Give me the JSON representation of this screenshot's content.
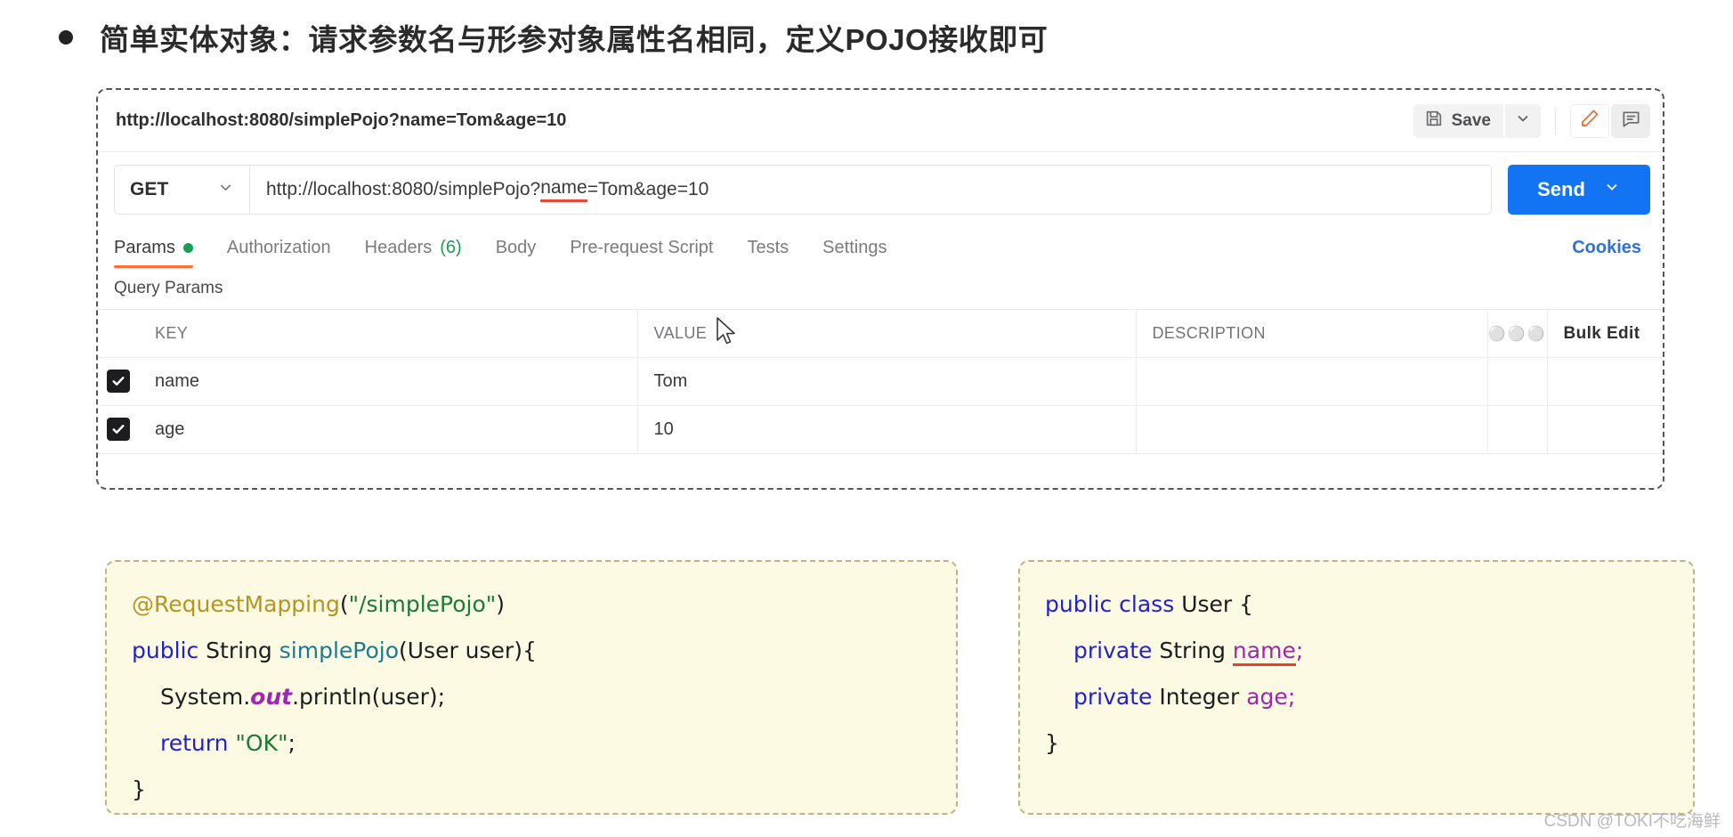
{
  "heading": {
    "bullet": "bullet-dot",
    "text": "简单实体对象：请求参数名与形参对象属性名相同，定义POJO接收即可"
  },
  "postman": {
    "request_name": "http://localhost:8080/simplePojo?name=Tom&age=10",
    "save_label": "Save",
    "save_caret_icon": "chevron-down-icon",
    "save_icon": "floppy-disk-icon",
    "edit_icon": "pencil-icon",
    "comment_icon": "comment-icon",
    "method": "GET",
    "method_caret_icon": "chevron-down-icon",
    "url_prefix": "http://localhost:8080/simplePojo?",
    "url_mark": "name",
    "url_suffix": "=Tom&age=10",
    "send_label": "Send",
    "send_caret_icon": "chevron-down-icon",
    "cookies_label": "Cookies",
    "tabs": [
      {
        "label": "Params",
        "badge": "green-dot",
        "active": true
      },
      {
        "label": "Authorization",
        "active": false
      },
      {
        "label": "Headers",
        "count": "(6)",
        "active": false
      },
      {
        "label": "Body",
        "active": false
      },
      {
        "label": "Pre-request Script",
        "active": false
      },
      {
        "label": "Tests",
        "active": false
      },
      {
        "label": "Settings",
        "active": false
      }
    ],
    "query_params_label": "Query Params",
    "table": {
      "headers": {
        "key": "KEY",
        "value": "VALUE",
        "description": "DESCRIPTION",
        "more_icon": "ellipsis-icon",
        "bulk_edit": "Bulk Edit"
      },
      "rows": [
        {
          "checked": true,
          "key": "name",
          "value": "Tom",
          "description": ""
        },
        {
          "checked": true,
          "key": "age",
          "value": "10",
          "description": ""
        }
      ]
    }
  },
  "code_left": {
    "line1": {
      "annotation": "@RequestMapping",
      "open": "(",
      "string": "\"/simplePojo\"",
      "close": ")"
    },
    "line2": {
      "kw": "public",
      "type": " String ",
      "method": "simplePojo",
      "rest": "(User user){"
    },
    "line3": {
      "a": "System.",
      "b": "out",
      "c": ".println(user);"
    },
    "line4": {
      "kw": "return ",
      "string": "\"OK\"",
      "semi": ";"
    },
    "line5": "}"
  },
  "code_right": {
    "line1": {
      "kw": "public class ",
      "name": "User {"
    },
    "line2": {
      "kw": "private",
      "type": " String ",
      "field": "name",
      "semi": ";"
    },
    "line3": {
      "kw": "private",
      "type": " Integer ",
      "field": "age",
      "semi": ";"
    },
    "line4": "}"
  },
  "watermark": "CSDN @TOKI不吃海鲜",
  "colors": {
    "accent_orange": "#ff6c37",
    "send_blue": "#1274f2",
    "link_blue": "#2d70e2",
    "green": "#1a9e52",
    "error_red": "#f03a2a",
    "code_bg": "#fdfae4"
  }
}
